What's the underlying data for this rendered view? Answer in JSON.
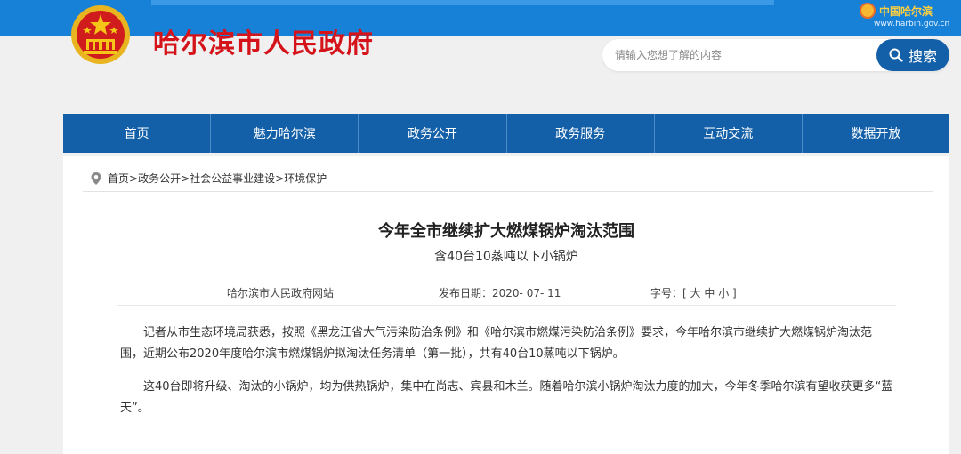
{
  "header": {
    "site_title": "哈尔滨市人民政府",
    "brand_name": "中国哈尔滨",
    "brand_url": "www.harbin.gov.cn"
  },
  "search": {
    "placeholder": "请输入您想了解的内容",
    "button_label": "搜索"
  },
  "nav": {
    "items": [
      "首页",
      "魅力哈尔滨",
      "政务公开",
      "政务服务",
      "互动交流",
      "数据开放"
    ]
  },
  "breadcrumb": {
    "items": [
      "首页",
      "政务公开",
      "社会公益事业建设",
      "环境保护"
    ],
    "separator": ">"
  },
  "article": {
    "title": "今年全市继续扩大燃煤锅炉淘汰范围",
    "subtitle": "含40台10蒸吨以下小锅炉",
    "source": "哈尔滨市人民政府网站",
    "date_label": "发布日期：",
    "date": "2020- 07- 11",
    "font_label": "字号：[",
    "font_large": "大",
    "font_medium": "中",
    "font_small": "小",
    "font_close": "]",
    "paragraphs": [
      "记者从市生态环境局获悉，按照《黑龙江省大气污染防治条例》和《哈尔滨市燃煤污染防治条例》要求，今年哈尔滨市继续扩大燃煤锅炉淘汰范围，近期公布2020年度哈尔滨市燃煤锅炉拟淘汰任务清单（第一批），共有40台10蒸吨以下锅炉。",
      "这40台即将升级、淘汰的小锅炉，均为供热锅炉，集中在尚志、宾县和木兰。随着哈尔滨小锅炉淘汰力度的加大，今年冬季哈尔滨有望收获更多“蓝天”。"
    ]
  },
  "colors": {
    "topbar": "#1781d8",
    "nav": "#1460a8",
    "title_red": "#d4141a"
  }
}
